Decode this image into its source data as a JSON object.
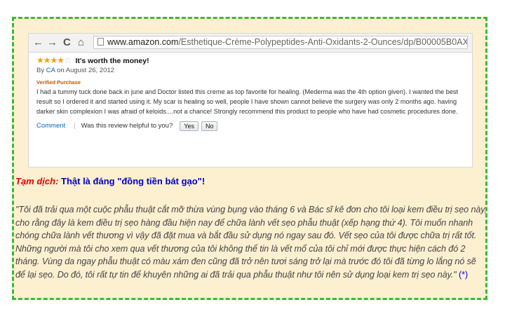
{
  "browser": {
    "back_icon": "←",
    "forward_icon": "→",
    "reload_icon": "C",
    "home_icon": "⌂",
    "url_host": "www.amazon.com",
    "url_path": "/Esthetique-Crème-Polypeptides-Anti-Oxidants-2-Ounces/dp/B00005B0AX"
  },
  "review": {
    "rating": 4,
    "rating_max": 5,
    "stars_on": "★★★★",
    "stars_off": "☆",
    "title": "It's worth the money!",
    "by_prefix": "By ",
    "author": "CA",
    "date": " on August 26, 2012",
    "verified": "Verified Purchase",
    "body": "I had a tummy tuck done back in june and Doctor listed this creme as top favorite for healing. (Mederma was the 4th option given). I wanted the best result so I ordered it and started using it. My scar is healing so well, people I have shown cannot believe the surgery was only 2 months ago. having darker skin complexion I was afraid of keloids....not a chance! Strongly recommend this product to people who have had cosmetic procedures done.",
    "comment_label": "Comment",
    "separator": "|",
    "helpful_question": "Was this review helpful to you?",
    "yes_label": "Yes",
    "no_label": "No"
  },
  "translation": {
    "label": "Tạm dịch:",
    "title": " Thật là đáng \"đồng tiền bát gạo\"!",
    "body": "\"Tôi đã trải qua một cuộc phẫu thuật cắt mỡ thừa vùng bụng vào tháng 6 và Bác sĩ kê đơn cho tôi loại kem điều trị sẹo này, cho rằng đây là kem điều trị sẹo hàng đầu hiện nay để chữa lành vết sẹo phẫu thuật (xếp hạng thứ 4). Tôi muốn nhanh chóng chữa lành vết thương vì vậy đã đặt mua và bắt đầu sử dụng nó ngay sau đó. Vết sẹo của tôi được chữa trị rất tốt. Những người mà tôi cho xem qua vết thương của tôi không thể tin là vết mổ của tôi chỉ mới được thực hiện cách đó 2 tháng. Vùng da ngay phẫu thuật có màu xám đen cũng đã trở nên tươi sáng trở lại mà trước đó tôi đã từng lo lắng nó sẽ để lại sẹo. Do đó, tôi rất tự tin để khuyên những ai đã trải qua phẫu thuật như tôi nên sử dụng loại kem trị sẹo này.\"",
    "ref_link": "(*)"
  },
  "colors": {
    "frame_border": "#3cb83c",
    "frame_bg": "#fdf0d0",
    "star": "#f0a400",
    "link": "#0066c0",
    "verified": "#c45500",
    "label_red": "#e00000",
    "title_blue": "#0000cc"
  }
}
